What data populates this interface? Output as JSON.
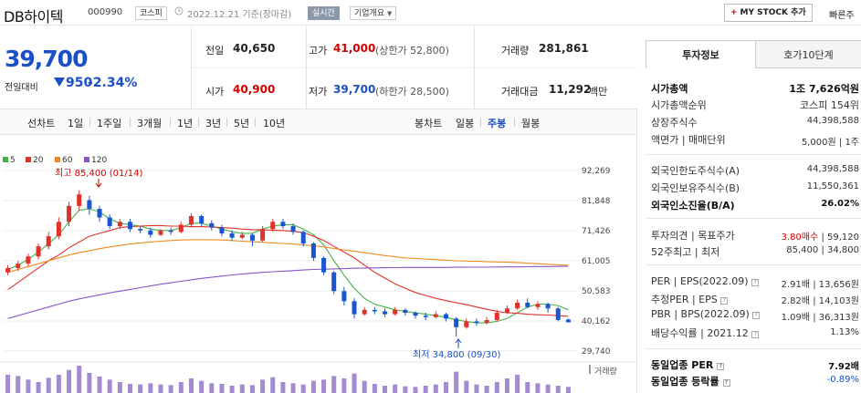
{
  "header": {
    "title": "DB하이텍",
    "code": "000990",
    "market": "코스피",
    "date": "2022.12.21 기준(장마감)",
    "realtime": "실시간",
    "company_info": "기업개요",
    "mystock": "MY STOCK 추가",
    "quickorder": "빠른주"
  },
  "quote": {
    "price": "39,700",
    "prev_label": "전일대비",
    "change": "950",
    "change_pct": "-2.34%",
    "prev_close_label": "전일",
    "prev_close": "40,650",
    "open_label": "시가",
    "open": "40,900",
    "high_label": "고가",
    "high": "41,000",
    "high_limit": "(상한가 52,800)",
    "low_label": "저가",
    "low": "39,700",
    "low_limit": "(하한가 28,500)",
    "volume_label": "거래량",
    "volume": "281,861",
    "value_label": "거래대금",
    "value": "11,292",
    "value_unit": "백만"
  },
  "chart_nav": {
    "line_label": "선차트",
    "ranges": [
      "1일",
      "1주일",
      "3개월",
      "1년",
      "3년",
      "5년",
      "10년"
    ],
    "candle_label": "봉차트",
    "candles": [
      "일봉",
      "주봉",
      "월봉"
    ],
    "active_candle": "주봉"
  },
  "legend": [
    {
      "label": "5",
      "color": "#44b044"
    },
    {
      "label": "20",
      "color": "#e0312a"
    },
    {
      "label": "60",
      "color": "#f08a1c"
    },
    {
      "label": "120",
      "color": "#8a55c8"
    }
  ],
  "annotations": {
    "max": "최고 85,400 (01/14)",
    "min": "최저 34,800 (09/30)"
  },
  "volume_label": "거래량",
  "chart_data": {
    "type": "line",
    "title": "",
    "y_ticks": [
      "92,269",
      "81,848",
      "71,426",
      "61,005",
      "50,583",
      "40,162",
      "29,740"
    ],
    "ylim": [
      29740,
      92269
    ],
    "series": [
      {
        "name": "5",
        "color": "#44b044",
        "values": [
          58000,
          59500,
          61500,
          64000,
          67000,
          70000,
          74500,
          78500,
          79000,
          78000,
          75500,
          74000,
          73500,
          73000,
          72000,
          71500,
          71500,
          72500,
          74000,
          74000,
          73000,
          72000,
          71000,
          70500,
          70500,
          72000,
          73000,
          73500,
          73500,
          72000,
          70000,
          66500,
          61000,
          56000,
          51500,
          48000,
          46000,
          45000,
          44000,
          43500,
          43000,
          42500,
          42000,
          41500,
          40500,
          40000,
          39500,
          39500,
          40000,
          41000,
          43000,
          45000,
          46000,
          46000,
          45500,
          44000
        ]
      },
      {
        "name": "20",
        "color": "#e0312a",
        "values": [
          51000,
          53500,
          56000,
          58500,
          61000,
          63000,
          65500,
          67500,
          69500,
          70500,
          71500,
          72500,
          72800,
          73000,
          73200,
          73200,
          73000,
          73000,
          72800,
          72800,
          72700,
          72500,
          72300,
          72000,
          71800,
          71700,
          71600,
          71500,
          71200,
          70800,
          69500,
          68000,
          66000,
          64000,
          62000,
          59500,
          57000,
          55000,
          53000,
          51500,
          50000,
          49000,
          48000,
          47200,
          46500,
          45800,
          45000,
          44200,
          43500,
          43000,
          42800,
          42500,
          42300,
          42200,
          42000,
          41800
        ]
      },
      {
        "name": "60",
        "color": "#f08a1c",
        "values": [
          57000,
          58000,
          59000,
          60000,
          61000,
          62000,
          63000,
          63800,
          64500,
          65200,
          65800,
          66300,
          66800,
          67200,
          67500,
          67800,
          68000,
          68200,
          68300,
          68300,
          68300,
          68200,
          68000,
          67800,
          67600,
          67400,
          67200,
          67000,
          66800,
          66500,
          66200,
          65800,
          65300,
          64800,
          64300,
          63800,
          63300,
          62800,
          62400,
          62000,
          61800,
          61600,
          61400,
          61200,
          61000,
          60900,
          60800,
          60700,
          60600,
          60500,
          60400,
          60200,
          60000,
          59800,
          59600,
          59500
        ]
      },
      {
        "name": "120",
        "color": "#8a55c8",
        "values": [
          41000,
          42000,
          43000,
          44000,
          45000,
          46000,
          47000,
          47800,
          48500,
          49200,
          49900,
          50500,
          51100,
          51700,
          52300,
          52900,
          53400,
          53900,
          54400,
          54900,
          55300,
          55700,
          56100,
          56400,
          56700,
          57000,
          57200,
          57400,
          57600,
          57800,
          58000,
          58100,
          58200,
          58300,
          58400,
          58500,
          58550,
          58600,
          58650,
          58700,
          58700,
          58700,
          58700,
          58700,
          58750,
          58800,
          58800,
          58800,
          58850,
          58900,
          58900,
          58950,
          59000,
          59000,
          59050,
          59100
        ]
      }
    ],
    "candles": [
      [
        57000,
        58500,
        59500,
        56000
      ],
      [
        58500,
        60000,
        61000,
        57500
      ],
      [
        60000,
        62500,
        63500,
        59000
      ],
      [
        62500,
        66000,
        67000,
        61500
      ],
      [
        66000,
        69500,
        71000,
        65000
      ],
      [
        69500,
        74500,
        76000,
        68500
      ],
      [
        74500,
        80000,
        81500,
        73000
      ],
      [
        80000,
        84000,
        85400,
        78500
      ],
      [
        82000,
        79000,
        83500,
        77000
      ],
      [
        79000,
        76000,
        80000,
        74500
      ],
      [
        76000,
        73000,
        77000,
        72000
      ],
      [
        73000,
        74500,
        75500,
        72000
      ],
      [
        74500,
        72000,
        75500,
        71000
      ],
      [
        72000,
        71500,
        73000,
        70500
      ],
      [
        71500,
        70000,
        72500,
        69000
      ],
      [
        70000,
        71500,
        72000,
        69500
      ],
      [
        71500,
        71000,
        72500,
        70000
      ],
      [
        71000,
        73500,
        74500,
        70500
      ],
      [
        73500,
        76500,
        77500,
        72500
      ],
      [
        76500,
        74000,
        77000,
        73000
      ],
      [
        74000,
        72500,
        75000,
        71500
      ],
      [
        72500,
        70500,
        73500,
        69500
      ],
      [
        70500,
        69000,
        71500,
        68000
      ],
      [
        69000,
        70000,
        71000,
        68500
      ],
      [
        70000,
        68000,
        70500,
        66000
      ],
      [
        68000,
        72000,
        73000,
        67500
      ],
      [
        72000,
        74500,
        75500,
        71000
      ],
      [
        74500,
        73000,
        75500,
        72000
      ],
      [
        73000,
        71000,
        74000,
        70000
      ],
      [
        71000,
        67000,
        71500,
        66000
      ],
      [
        67000,
        62000,
        67500,
        61000
      ],
      [
        62000,
        57000,
        62500,
        56000
      ],
      [
        57000,
        50500,
        57500,
        49500
      ],
      [
        50500,
        47000,
        52000,
        45500
      ],
      [
        47000,
        42500,
        48000,
        41000
      ],
      [
        42500,
        44000,
        45000,
        42000
      ],
      [
        44000,
        43500,
        45000,
        42500
      ],
      [
        43500,
        42500,
        44500,
        41500
      ],
      [
        42500,
        44000,
        45000,
        42000
      ],
      [
        44000,
        43000,
        44500,
        42000
      ],
      [
        43000,
        42000,
        43500,
        41000
      ],
      [
        42000,
        41500,
        43000,
        40500
      ],
      [
        41500,
        42500,
        43500,
        41000
      ],
      [
        42500,
        41000,
        43000,
        40000
      ],
      [
        41000,
        38000,
        41500,
        34800
      ],
      [
        38000,
        40000,
        41000,
        37500
      ],
      [
        40000,
        39500,
        41000,
        38500
      ],
      [
        39500,
        40500,
        41500,
        39000
      ],
      [
        40500,
        43000,
        44000,
        40000
      ],
      [
        43000,
        44500,
        45500,
        42500
      ],
      [
        44500,
        46500,
        47500,
        44000
      ],
      [
        46500,
        45000,
        48000,
        44500
      ],
      [
        45000,
        46000,
        47000,
        44000
      ],
      [
        46000,
        44500,
        46500,
        43000
      ],
      [
        44500,
        40500,
        45000,
        40000
      ],
      [
        40650,
        39700,
        41000,
        39700
      ]
    ],
    "volume": [
      30,
      28,
      22,
      18,
      25,
      30,
      38,
      45,
      33,
      27,
      22,
      18,
      15,
      14,
      16,
      14,
      13,
      18,
      24,
      20,
      16,
      15,
      12,
      14,
      13,
      22,
      26,
      18,
      16,
      14,
      20,
      22,
      28,
      24,
      32,
      20,
      15,
      12,
      14,
      11,
      10,
      12,
      14,
      18,
      35,
      20,
      14,
      12,
      18,
      24,
      30,
      18,
      16,
      14,
      12,
      10
    ]
  },
  "panel": {
    "tab_invest": "투자정보",
    "tab_hoga": "호가10단계",
    "market_cap_label": "시가총액",
    "market_cap": "1조 7,626억원",
    "rank_label": "시가총액순위",
    "rank": "코스피 154위",
    "shares_label": "상장주식수",
    "shares": "44,398,588",
    "par_label": "액면가",
    "trade_unit_label": "매매단위",
    "par": "5,000원",
    "trade_unit": "1주",
    "foreign_limit_label": "외국인한도주식수(A)",
    "foreign_limit": "44,398,588",
    "foreign_hold_label": "외국인보유주식수(B)",
    "foreign_hold": "11,550,361",
    "foreign_ratio_label": "외국인소진율(B/A)",
    "foreign_ratio": "26.02%",
    "opinion_label": "투자의견",
    "target_label": "목표주가",
    "opinion": "3.80매수",
    "target": "59,120",
    "w52_high_label": "52주최고",
    "w52_low_label": "최저",
    "w52_high": "85,400",
    "w52_low": "34,800",
    "per_label": "PER",
    "eps_label": "EPS(2022.09)",
    "per": "2.91배",
    "eps": "13,656원",
    "est_per_label": "추정PER",
    "est_eps_label": "EPS",
    "est_per": "2.82배",
    "est_eps": "14,103원",
    "pbr_label": "PBR",
    "bps_label": "BPS(2022.09)",
    "pbr": "1.09배",
    "bps": "36,313원",
    "div_label": "배당수익률",
    "div_date": "2021.12",
    "div": "1.13%",
    "sector_per_label": "동일업종 PER",
    "sector_per": "7.92배",
    "sector_chg_label": "동일업종 등락률",
    "sector_chg": "-0.89%"
  }
}
